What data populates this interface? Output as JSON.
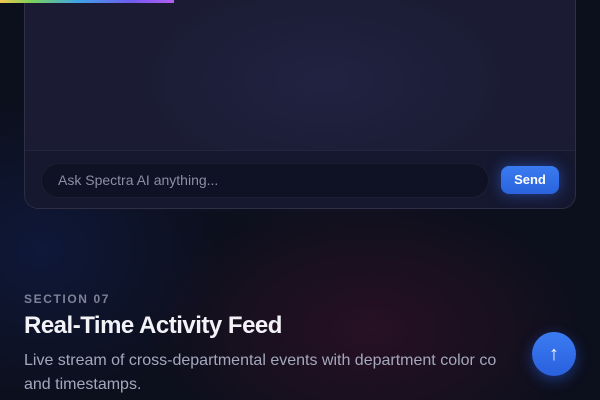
{
  "page_progress": 0.29,
  "chat": {
    "input_placeholder": "Ask Spectra AI anything...",
    "send_label": "Send"
  },
  "section": {
    "eyebrow": "SECTION 07",
    "title": "Real-Time Activity Feed",
    "description_line1": "Live stream of cross-departmental events with department color co",
    "description_line2": "and timestamps."
  },
  "scroll_top": {
    "icon": "arrow-up-icon",
    "glyph": "↑"
  },
  "colors": {
    "accent": "#2f6ce6",
    "background": "#0c0f1c",
    "card": "#1b1c34"
  }
}
